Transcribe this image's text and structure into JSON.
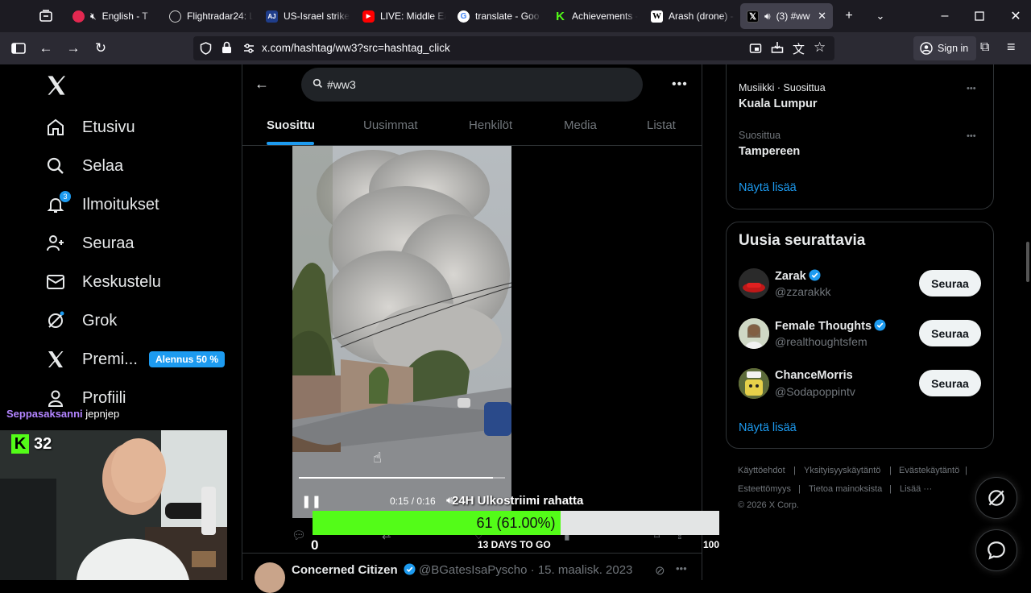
{
  "browser": {
    "tabs": [
      {
        "title": "English - T",
        "icon": "stream-icon",
        "color": "#e22850"
      },
      {
        "title": "Flightradar24: L",
        "icon": "radar-icon",
        "color": "#cfcfcf"
      },
      {
        "title": "US-Israel strikes",
        "icon": "news-icon",
        "color": "#1f3d8a"
      },
      {
        "title": "LIVE: Middle Ea",
        "icon": "youtube-icon",
        "color": "#ff0000"
      },
      {
        "title": "translate - Goo",
        "icon": "google-icon",
        "color": "#ffffff"
      },
      {
        "title": "Achievements -",
        "icon": "kick-icon",
        "color": "#53fc18"
      },
      {
        "title": "Arash (drone) -",
        "icon": "wikipedia-icon",
        "color": "#ffffff"
      },
      {
        "title": "(3) #ww",
        "icon": "x-icon",
        "color": "#000000"
      }
    ],
    "url": "x.com/hashtag/ww3?src=hashtag_click",
    "sign_in": "Sign in"
  },
  "leftnav": {
    "items": [
      {
        "label": "Etusivu",
        "icon": "home-icon"
      },
      {
        "label": "Selaa",
        "icon": "search-icon"
      },
      {
        "label": "Ilmoitukset",
        "icon": "bell-icon",
        "badge": "3"
      },
      {
        "label": "Seuraa",
        "icon": "add-person-icon"
      },
      {
        "label": "Keskustelu",
        "icon": "mail-icon"
      },
      {
        "label": "Grok",
        "icon": "grok-icon"
      },
      {
        "label": "Premi...",
        "icon": "x-premium-icon"
      },
      {
        "label": "Profiili",
        "icon": "person-icon"
      }
    ],
    "premium_badge": "Alennus 50 %"
  },
  "stream_overlay": {
    "chat_user": "Seppasaksanni",
    "chat_message": "jepnjep",
    "kick_count": "32",
    "banner": "24H Ulkostriimi rahatta",
    "goal_value": "61 (61.00%)",
    "goal_fraction": 0.61,
    "goal_min": "0",
    "goal_max": "100",
    "goal_days": "13 DAYS TO GO"
  },
  "main": {
    "search_query": "#ww3",
    "tabs": [
      "Suosittu",
      "Uusimmat",
      "Henkilöt",
      "Media",
      "Listat"
    ],
    "active_tab": "Suosittu",
    "video_time": "0:15 / 0:16",
    "video_progress": 0.94,
    "next_tweet": {
      "name": "Concerned Citizen",
      "handle": "@BGatesIsaPyscho",
      "date": "15. maalisk. 2023"
    }
  },
  "right": {
    "trends": [
      {
        "category": "Musiikki · Suosittua",
        "name": "Kuala Lumpur"
      },
      {
        "category": "Suosittua",
        "name": "Tampereen"
      }
    ],
    "show_more": "Näytä lisää",
    "who_to_follow": {
      "title": "Uusia seurattavia",
      "users": [
        {
          "name": "Zarak",
          "handle": "@zzarakkk",
          "button": "Seuraa"
        },
        {
          "name": "Female Thoughts",
          "handle": "@realthoughtsfem",
          "button": "Seuraa"
        },
        {
          "name": "ChanceMorris",
          "handle": "@Sodapoppintv",
          "button": "Seuraa"
        }
      ],
      "show_more": "Näytä lisää"
    },
    "footer": {
      "links": [
        "Käyttöehdot",
        "Yksityisyyskäytäntö",
        "Evästekäytäntö",
        "Esteettömyys",
        "Tietoa mainoksista",
        "Lisää ···"
      ],
      "copyright": "© 2026 X Corp."
    }
  },
  "colors": {
    "accent": "#1d9bf0",
    "goal_green": "#53fc18",
    "chat_user": "#b284ff"
  }
}
